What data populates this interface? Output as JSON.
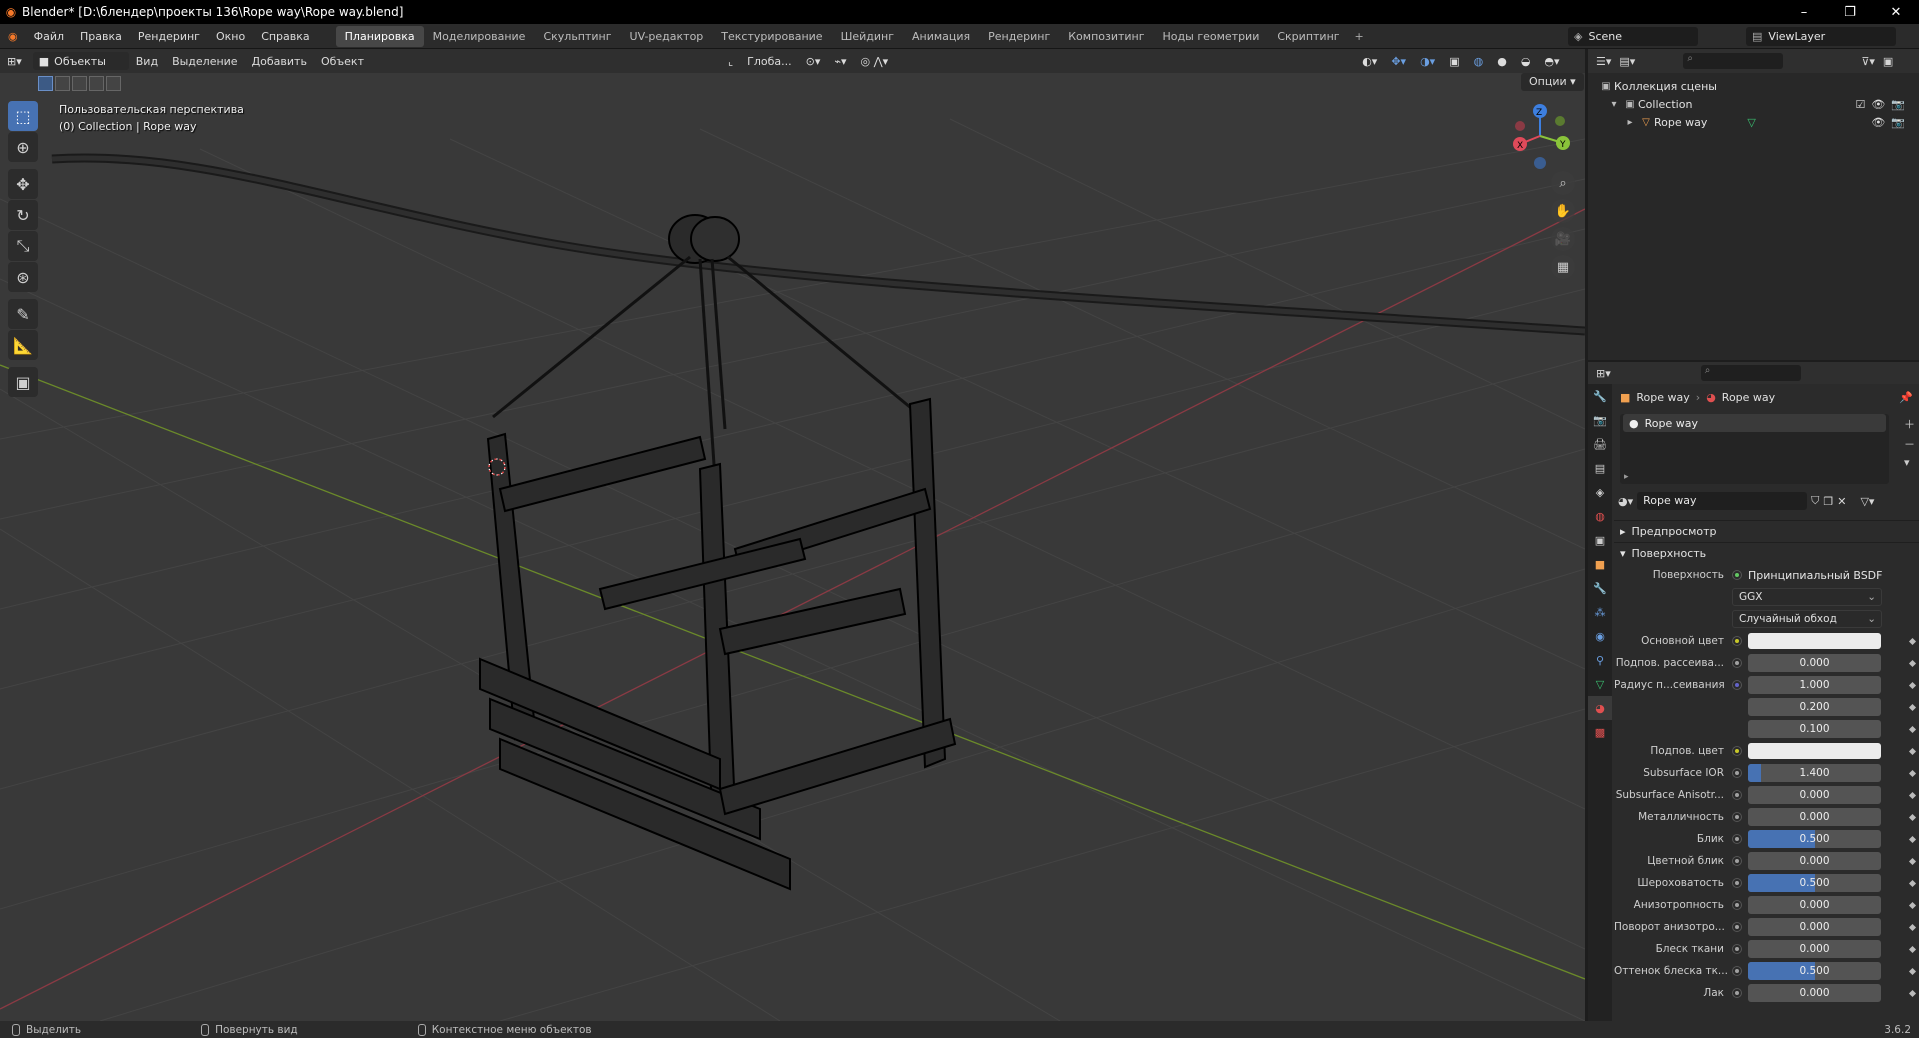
{
  "window": {
    "title": "Blender* [D:\\блендер\\проекты 136\\Rope way\\Rope way.blend]",
    "minimize": "–",
    "maximize": "❐",
    "close": "✕"
  },
  "menu": {
    "items": [
      "Файл",
      "Правка",
      "Рендеринг",
      "Окно",
      "Справка"
    ],
    "workspaces": [
      {
        "label": "Планировка",
        "active": true
      },
      {
        "label": "Моделирование"
      },
      {
        "label": "Скульптинг"
      },
      {
        "label": "UV-редактор"
      },
      {
        "label": "Текстурирование"
      },
      {
        "label": "Шейдинг"
      },
      {
        "label": "Анимация"
      },
      {
        "label": "Рендеринг"
      },
      {
        "label": "Композитинг"
      },
      {
        "label": "Ноды геометрии"
      },
      {
        "label": "Скриптинг"
      }
    ],
    "add_workspace": "+",
    "scene": "Scene",
    "view_layer": "ViewLayer"
  },
  "viewport": {
    "mode": "Объекты",
    "header_menus": [
      "Вид",
      "Выделение",
      "Добавить",
      "Объект"
    ],
    "transform_orientation": "Глоба...",
    "options": "Опции",
    "perspective_label": "Пользовательская перспектива",
    "collection_label": "(0) Collection | Rope way",
    "gizmo": {
      "x": "X",
      "y": "Y",
      "z": "Z"
    },
    "colors": {
      "background": "#393939",
      "grid": "#454545",
      "x_axis": "#8a3a44",
      "y_axis": "#6b8a2a",
      "wire": "#000000"
    }
  },
  "outliner": {
    "root": "Коллекция сцены",
    "collection": "Collection",
    "object": "Rope way"
  },
  "properties": {
    "breadcrumb": [
      "Rope way",
      "Rope way"
    ],
    "slot": "Rope way",
    "material_name": "Rope way",
    "panels": {
      "preview": "Предпросмотр",
      "surface": "Поверхность"
    },
    "surface_label": "Поверхность",
    "surface_value": "Принципиальный BSDF",
    "distribution": "GGX",
    "subsurface_method": "Случайный обход",
    "rows": [
      {
        "label": "Основной цвет",
        "type": "color",
        "socket": "yellow"
      },
      {
        "label": "Подпов. рассеива...",
        "type": "slider",
        "value": "0.000",
        "fill": 0,
        "socket": "grey"
      },
      {
        "label": "Радиус п...сеивания",
        "type": "slider",
        "value": "1.000",
        "fill": 0,
        "socket": "blue"
      },
      {
        "label": "",
        "type": "slider",
        "value": "0.200",
        "fill": 0,
        "socket": "none"
      },
      {
        "label": "",
        "type": "slider",
        "value": "0.100",
        "fill": 0,
        "socket": "none"
      },
      {
        "label": "Подпов. цвет",
        "type": "color",
        "socket": "yellow"
      },
      {
        "label": "Subsurface IOR",
        "type": "slider",
        "value": "1.400",
        "fill": 0.1,
        "socket": "grey"
      },
      {
        "label": "Subsurface Anisotr...",
        "type": "slider",
        "value": "0.000",
        "fill": 0,
        "socket": "grey"
      },
      {
        "label": "Металличность",
        "type": "slider",
        "value": "0.000",
        "fill": 0,
        "socket": "grey"
      },
      {
        "label": "Блик",
        "type": "slider",
        "value": "0.500",
        "fill": 0.5,
        "socket": "grey"
      },
      {
        "label": "Цветной блик",
        "type": "slider",
        "value": "0.000",
        "fill": 0,
        "socket": "grey"
      },
      {
        "label": "Шероховатость",
        "type": "slider",
        "value": "0.500",
        "fill": 0.5,
        "socket": "grey"
      },
      {
        "label": "Анизотропность",
        "type": "slider",
        "value": "0.000",
        "fill": 0,
        "socket": "grey"
      },
      {
        "label": "Поворот анизотро...",
        "type": "slider",
        "value": "0.000",
        "fill": 0,
        "socket": "grey"
      },
      {
        "label": "Блеск ткани",
        "type": "slider",
        "value": "0.000",
        "fill": 0,
        "socket": "grey"
      },
      {
        "label": "Оттенок блеска тк...",
        "type": "slider",
        "value": "0.500",
        "fill": 0.5,
        "socket": "grey"
      },
      {
        "label": "Лак",
        "type": "slider",
        "value": "0.000",
        "fill": 0,
        "socket": "grey"
      }
    ]
  },
  "statusbar": {
    "select": "Выделить",
    "rotate": "Повернуть вид",
    "context": "Контекстное меню объектов",
    "version": "3.6.2"
  }
}
